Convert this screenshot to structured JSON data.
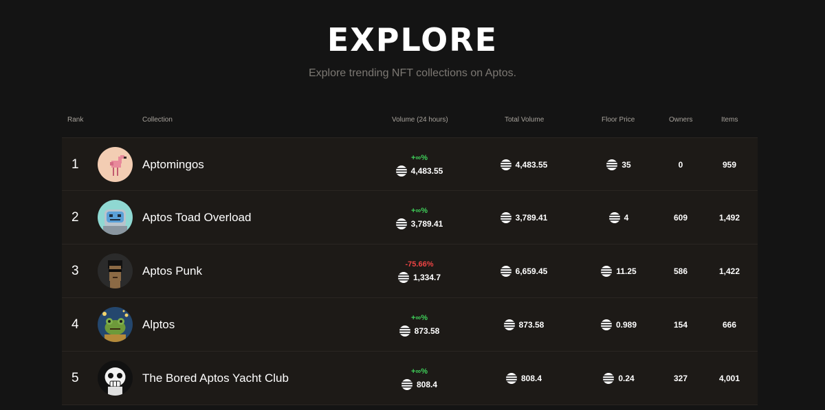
{
  "header": {
    "title": "EXPLORE",
    "subtitle": "Explore trending NFT collections on Aptos."
  },
  "table": {
    "columns": {
      "rank": "Rank",
      "collection": "Collection",
      "volume_24h": "Volume (24 hours)",
      "total_volume": "Total Volume",
      "floor_price": "Floor Price",
      "owners": "Owners",
      "items": "Items"
    },
    "rows": [
      {
        "rank": "1",
        "name": "Aptomingos",
        "change": "+∞%",
        "change_dir": "up",
        "volume_24h": "4,483.55",
        "total_volume": "4,483.55",
        "floor_price": "35",
        "owners": "0",
        "items": "959"
      },
      {
        "rank": "2",
        "name": "Aptos Toad Overload",
        "change": "+∞%",
        "change_dir": "up",
        "volume_24h": "3,789.41",
        "total_volume": "3,789.41",
        "floor_price": "4",
        "owners": "609",
        "items": "1,492"
      },
      {
        "rank": "3",
        "name": "Aptos Punk",
        "change": "-75.66%",
        "change_dir": "down",
        "volume_24h": "1,334.7",
        "total_volume": "6,659.45",
        "floor_price": "11.25",
        "owners": "586",
        "items": "1,422"
      },
      {
        "rank": "4",
        "name": "Alptos",
        "change": "+∞%",
        "change_dir": "up",
        "volume_24h": "873.58",
        "total_volume": "873.58",
        "floor_price": "0.989",
        "owners": "154",
        "items": "666"
      },
      {
        "rank": "5",
        "name": "The Bored Aptos Yacht Club",
        "change": "+∞%",
        "change_dir": "up",
        "volume_24h": "808.4",
        "total_volume": "808.4",
        "floor_price": "0.24",
        "owners": "327",
        "items": "4,001"
      }
    ]
  },
  "icons": {
    "currency": "aptos-coin-icon",
    "avatars": [
      "flamingo-avatar-icon",
      "toad-avatar-icon",
      "punk-avatar-icon",
      "frog-avatar-icon",
      "ape-skull-avatar-icon"
    ]
  },
  "colors": {
    "background": "#141414",
    "row_background": "#1d1a17",
    "positive": "#3fd05a",
    "negative": "#ef4444"
  }
}
